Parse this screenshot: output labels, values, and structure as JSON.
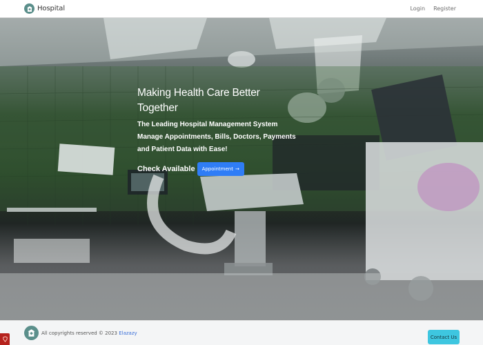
{
  "navbar": {
    "brand": "Hospital",
    "links": [
      "Login",
      "Register"
    ]
  },
  "hero": {
    "title": "Making Health Care Better Together",
    "subtitle": "The Leading Hospital Management System Manage Appointments, Bills, Doctors, Payments and Patient Data with Ease!",
    "cta_text": "Check Available",
    "cta_button": "Appointment",
    "cta_arrow": "→",
    "background": "operating-room-photo"
  },
  "footer": {
    "copyright": "All copyrights reserved © 2023",
    "author": "Elazazy",
    "contact_button": "Contact Us"
  },
  "icons": {
    "brand_logo": "hospital-building-icon",
    "corner": "laravel-icon"
  },
  "colors": {
    "primary_button": "#2f7df6",
    "contact_button": "#3ec6e0",
    "logo_bg": "#5b8f8b"
  }
}
